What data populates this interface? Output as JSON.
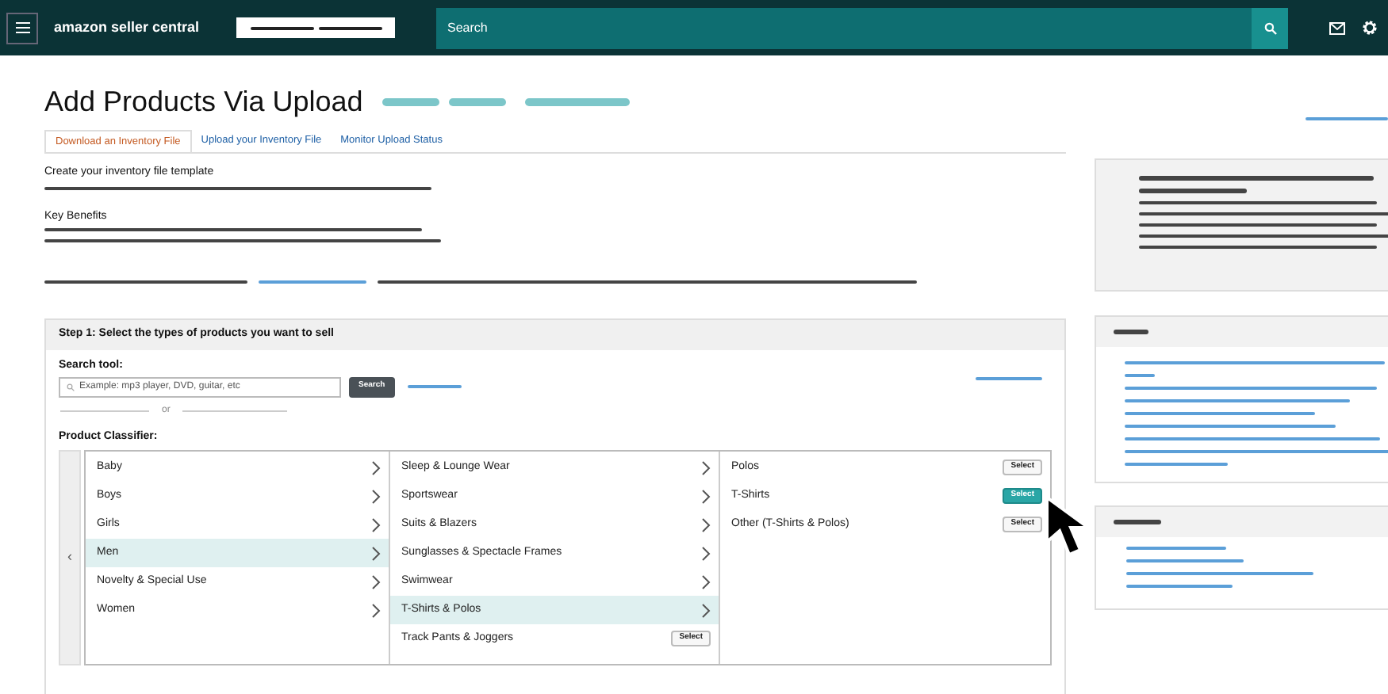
{
  "header": {
    "brand": "amazon seller central",
    "search_placeholder": "Search"
  },
  "page": {
    "title": "Add Products Via Upload"
  },
  "tabs": [
    {
      "label": "Download an Inventory File",
      "selected": true
    },
    {
      "label": "Upload your Inventory File",
      "selected": false
    },
    {
      "label": "Monitor Upload Status",
      "selected": false
    }
  ],
  "intro": {
    "heading": "Create your inventory file template",
    "benefits_heading": "Key Benefits"
  },
  "step": {
    "title": "Step 1:  Select the types of products you want to sell",
    "search_label": "Search tool:",
    "search_placeholder": "Example: mp3 player, DVD, guitar, etc",
    "search_button": "Search",
    "or_text": "or",
    "classifier_label": "Product Classifier:"
  },
  "classifier": {
    "back": "‹",
    "columns": [
      {
        "items": [
          {
            "label": "Baby",
            "kind": "category",
            "selected": false
          },
          {
            "label": "Boys",
            "kind": "category",
            "selected": false
          },
          {
            "label": "Girls",
            "kind": "category",
            "selected": false
          },
          {
            "label": "Men",
            "kind": "category",
            "selected": true
          },
          {
            "label": "Novelty & Special Use",
            "kind": "category",
            "selected": false
          },
          {
            "label": "Women",
            "kind": "category",
            "selected": false
          }
        ]
      },
      {
        "items": [
          {
            "label": "Sleep & Lounge Wear",
            "kind": "category",
            "selected": false
          },
          {
            "label": "Sportswear",
            "kind": "category",
            "selected": false
          },
          {
            "label": "Suits & Blazers",
            "kind": "category",
            "selected": false
          },
          {
            "label": "Sunglasses & Spectacle Frames",
            "kind": "category",
            "selected": false
          },
          {
            "label": "Swimwear",
            "kind": "category",
            "selected": false
          },
          {
            "label": "T-Shirts & Polos",
            "kind": "category",
            "selected": true
          },
          {
            "label": "Track Pants & Joggers",
            "kind": "leaf",
            "selected": false,
            "button": "Select"
          }
        ]
      },
      {
        "items": [
          {
            "label": "Polos",
            "kind": "leaf",
            "selected": false,
            "button": "Select"
          },
          {
            "label": "T-Shirts",
            "kind": "leaf",
            "selected": true,
            "button": "Select"
          },
          {
            "label": "Other (T-Shirts & Polos)",
            "kind": "leaf",
            "selected": false,
            "button": "Select"
          }
        ]
      }
    ]
  }
}
